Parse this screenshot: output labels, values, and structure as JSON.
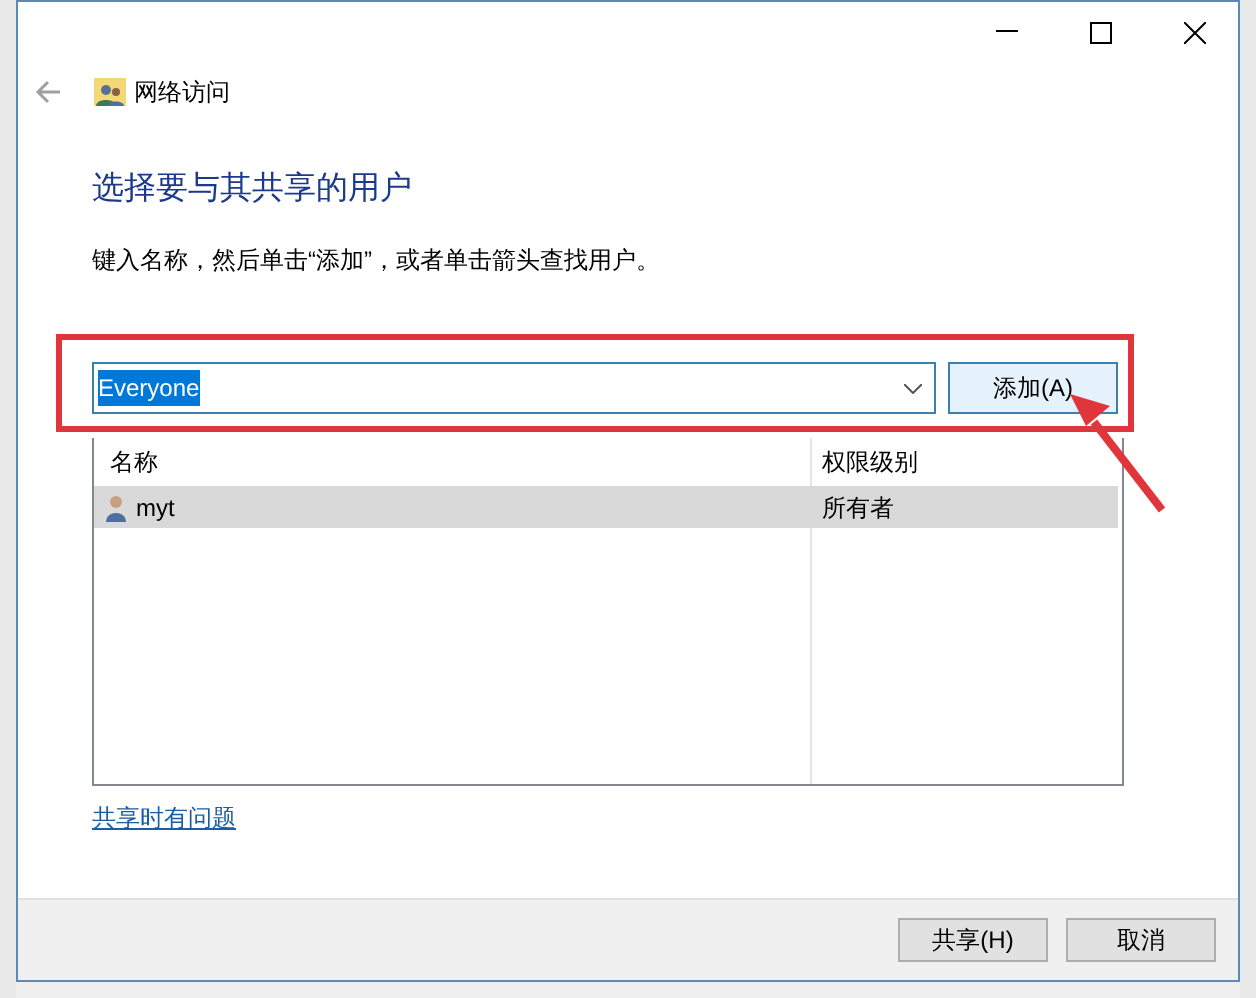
{
  "window": {
    "title": "网络访问"
  },
  "heading": "选择要与其共享的用户",
  "instruction": "键入名称，然后单击“添加”，或者单击箭头查找用户。",
  "name_field": {
    "value": "Everyone",
    "text_selected": true
  },
  "add_button": "添加(A)",
  "table": {
    "columns": [
      "名称",
      "权限级别"
    ],
    "rows": [
      {
        "name": "myt",
        "level": "所有者",
        "selected": true
      }
    ]
  },
  "help_link": "共享时有问题",
  "buttons": [
    {
      "label": "共享(H)",
      "disabled": false
    },
    {
      "label": "取消",
      "disabled": false
    }
  ]
}
